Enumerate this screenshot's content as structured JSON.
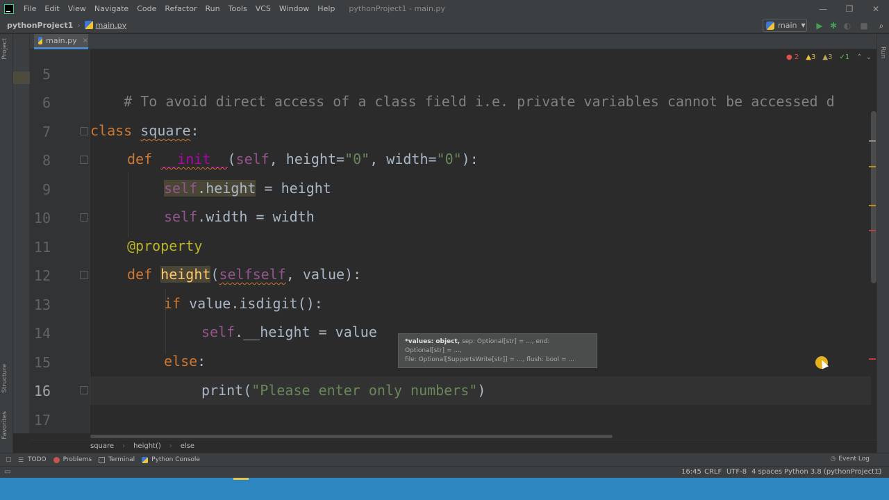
{
  "window": {
    "menu": [
      "File",
      "Edit",
      "View",
      "Navigate",
      "Code",
      "Refactor",
      "Run",
      "Tools",
      "VCS",
      "Window",
      "Help"
    ],
    "title": "pythonProject1 - main.py",
    "controls": [
      "—",
      "❐",
      "✕"
    ]
  },
  "navbar": {
    "project": "pythonProject1",
    "file": "main.py",
    "run_config": "main"
  },
  "side": {
    "project_label": "Project",
    "structure_label": "Structure",
    "favorites_label": "Favorites",
    "run_label": "Run"
  },
  "tabs": [
    {
      "label": "main.py",
      "close": "×"
    }
  ],
  "inspections": {
    "errors": "2",
    "warnings": "3",
    "weak_warnings": "3",
    "ok": "1"
  },
  "code": {
    "line_numbers": [
      "5",
      "6",
      "7",
      "8",
      "9",
      "10",
      "11",
      "12",
      "13",
      "14",
      "15",
      "16",
      "17"
    ],
    "current_line": "16",
    "line5_comment": "# To avoid direct access of a class field i.e. private variables cannot be accessed d",
    "kw_class": "class",
    "class_name": "square",
    "colon": ":",
    "kw_def": "def",
    "init_name": "__init__",
    "self": "self",
    "init_params_a": ", height=",
    "str_zero": "\"0\"",
    "init_params_b": ", width=",
    "init_close": "):",
    "attr_height_assign": ".height",
    "assign_height_rhs": " = height",
    "attr_width_assign": ".width = width",
    "decorator": "@property",
    "height_fn": "height",
    "open_paren": "(",
    "selfself": "selfself",
    "height_params": ", value):",
    "kw_if": "if",
    "if_expr": " value.isdigit():",
    "private_assign": ".__height = value",
    "kw_else": "else",
    "print_call": "print(",
    "print_str": "\"Please enter only numbers\"",
    "close_paren": ")"
  },
  "tooltip": {
    "bold": "*values: object,",
    "rest": " sep: Optional[str] = ..., end: Optional[str] = ...,",
    "line2": "file: Optional[SupportsWrite[str]] = ..., flush: bool = ..."
  },
  "breadcrumb": [
    "square",
    "height()",
    "else"
  ],
  "bottom_tools": [
    "TODO",
    "Problems",
    "Terminal",
    "Python Console"
  ],
  "event_log": "Event Log",
  "status": {
    "position": "16:45",
    "line_sep": "CRLF",
    "encoding": "UTF-8",
    "indent": "4 spaces",
    "interpreter": "Python 3.8 (pythonProject1)"
  },
  "colors": {
    "keyword": "#cc7832",
    "function": "#ffc66d",
    "string": "#6a8759",
    "self": "#94558d",
    "decorator": "#bbb529",
    "accent": "#4a88c7"
  }
}
